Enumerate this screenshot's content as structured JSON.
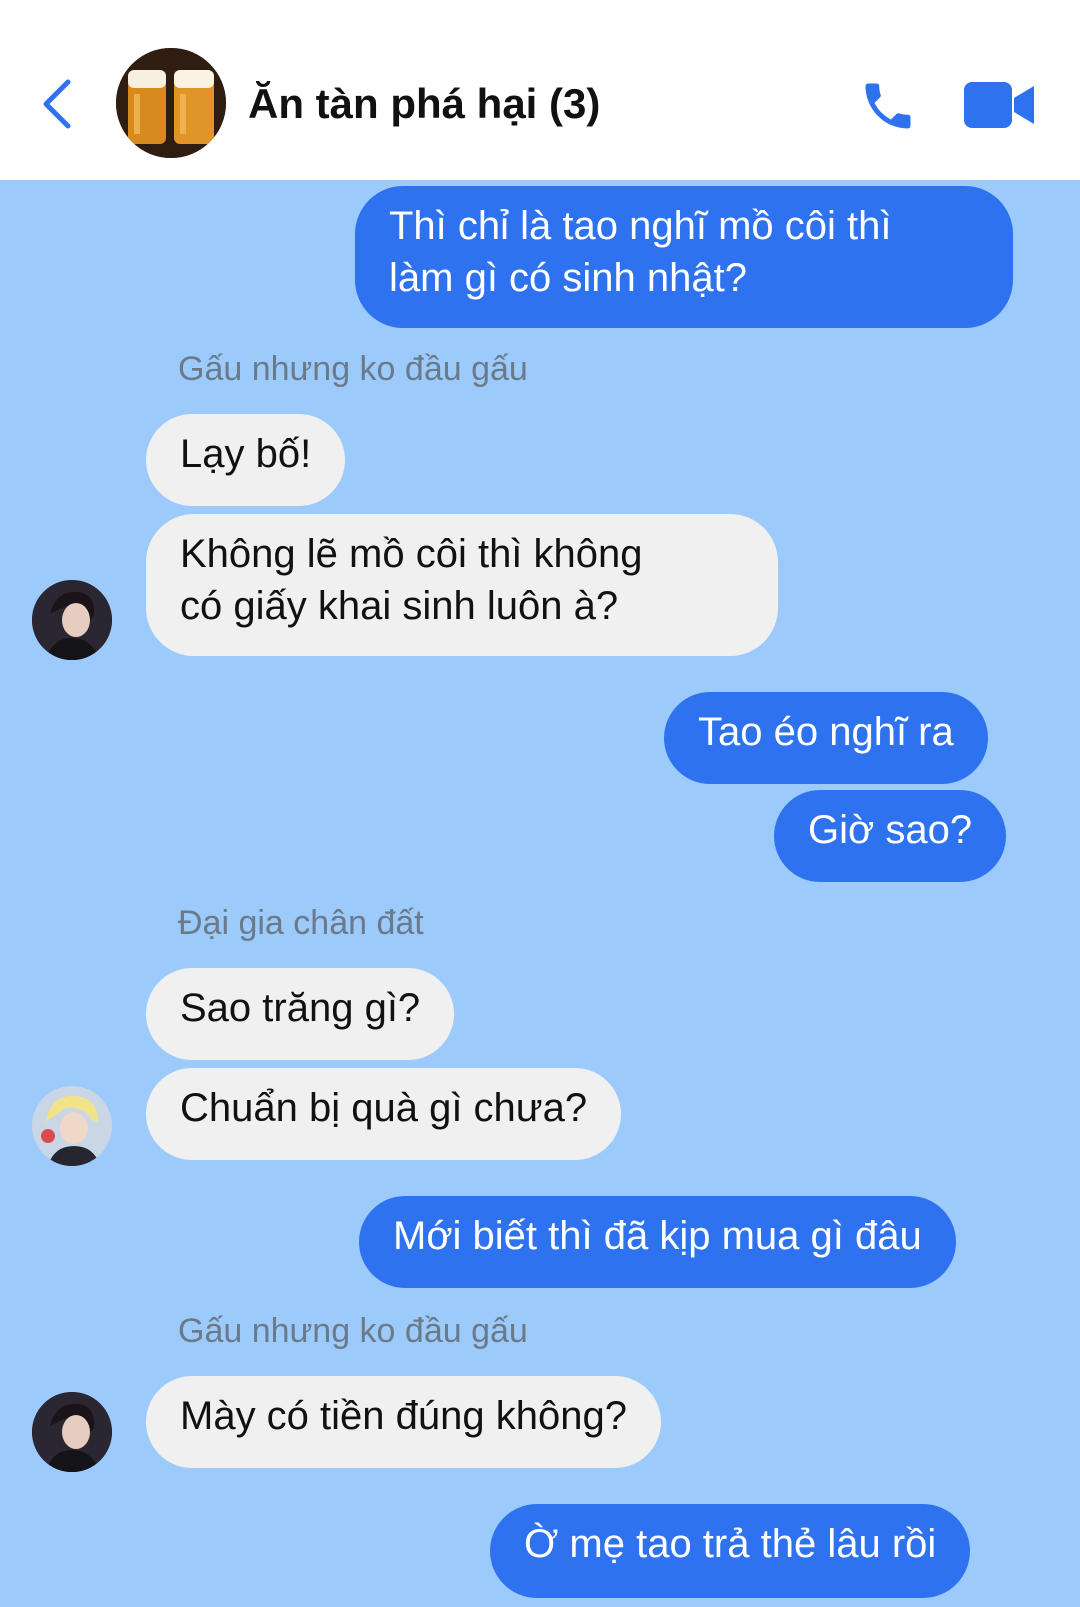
{
  "header": {
    "title": "Ăn tàn phá hại (3)",
    "back_icon": "chevron-left-icon",
    "call_icon": "phone-icon",
    "video_icon": "video-camera-icon",
    "accent": "#2f72f0"
  },
  "messages": [
    {
      "dir": "out",
      "lines": [
        "Thì chỉ là tao nghĩ mồ côi thì",
        "làm gì có sinh nhật?"
      ]
    },
    {
      "dir": "in",
      "sender": "Gấu nhưng ko đầu gấu",
      "lines": [
        "Lạy bố!"
      ]
    },
    {
      "dir": "in",
      "lines": [
        "Không lẽ mồ côi thì không",
        "có giấy khai sinh luôn à?"
      ]
    },
    {
      "dir": "out",
      "lines": [
        "Tao éo nghĩ ra"
      ]
    },
    {
      "dir": "out",
      "lines": [
        "Giờ sao?"
      ]
    },
    {
      "dir": "in",
      "sender": "Đại gia chân đất",
      "lines": [
        "Sao trăng gì?"
      ]
    },
    {
      "dir": "in",
      "lines": [
        "Chuẩn bị quà gì chưa?"
      ]
    },
    {
      "dir": "out",
      "lines": [
        "Mới biết thì đã kịp mua gì đâu"
      ]
    },
    {
      "dir": "in",
      "sender": "Gấu nhưng ko đầu gấu",
      "lines": [
        "Mày có tiền đúng không?"
      ]
    },
    {
      "dir": "out",
      "lines": [
        "Ờ mẹ tao trả thẻ lâu rồi"
      ]
    }
  ],
  "colors": {
    "chat_background": "#9ccbfb",
    "outgoing_bubble": "#2f72f0",
    "incoming_bubble": "#f0f0f0"
  }
}
